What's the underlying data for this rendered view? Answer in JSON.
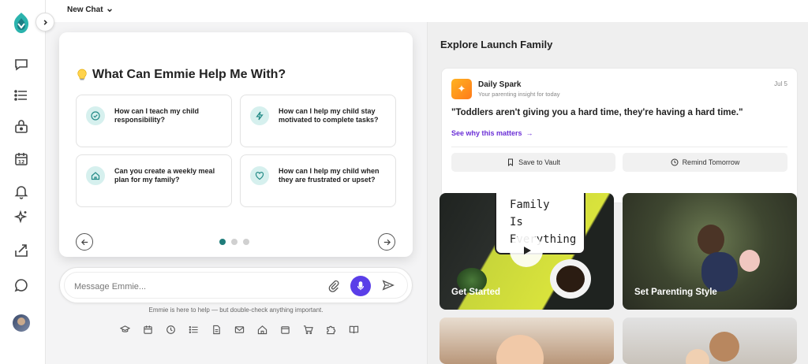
{
  "topbar": {
    "new_chat_label": "New Chat"
  },
  "sidebar": {
    "items": [
      {
        "icon": "chat-bubble-icon"
      },
      {
        "icon": "list-icon"
      },
      {
        "icon": "lock-briefcase-icon"
      },
      {
        "icon": "calendar-icon",
        "badge": "12"
      },
      {
        "icon": "bell-icon"
      },
      {
        "icon": "sparkle-icon"
      },
      {
        "icon": "share-icon"
      },
      {
        "icon": "message-circle-icon"
      }
    ]
  },
  "help": {
    "title": "What Can Emmie Help Me With?",
    "questions": [
      {
        "text": "How can I teach my child responsibility?",
        "icon": "check-circle-icon"
      },
      {
        "text": "How can I help my child stay motivated to complete tasks?",
        "icon": "lightning-icon"
      },
      {
        "text": "Can you create a weekly meal plan for my family?",
        "icon": "home-icon"
      },
      {
        "text": "How can I help my child when they are frustrated or upset?",
        "icon": "heart-icon"
      }
    ],
    "pagination": {
      "pages": 3,
      "current": 1
    }
  },
  "composer": {
    "placeholder": "Message Emmie...",
    "value": "",
    "disclaimer": "Emmie is here to help — but double-check anything important."
  },
  "tools": [
    "graduation-cap-icon",
    "calendar-icon",
    "clock-icon",
    "list-icon",
    "document-icon",
    "mail-icon",
    "home-icon",
    "calendar-alt-icon",
    "cart-icon",
    "puzzle-icon",
    "book-icon"
  ],
  "explore": {
    "title": "Explore Launch Family",
    "daily_spark": {
      "name": "Daily Spark",
      "subtitle": "Your parenting insight for today",
      "date": "Jul 5",
      "quote": "\"Toddlers aren't giving you a hard time, they're having a hard time.\"",
      "link_label": "See why this matters",
      "save_label": "Save to Vault",
      "remind_label": "Remind Tomorrow"
    },
    "tiles": [
      {
        "label": "Get Started",
        "board_text": "Family\nIs\nEverything"
      },
      {
        "label": "Set Parenting Style"
      },
      {
        "label": ""
      },
      {
        "label": ""
      }
    ]
  },
  "colors": {
    "accent": "#5a3ee8",
    "teal": "#1f7c7a",
    "link": "#6b2fd6"
  }
}
